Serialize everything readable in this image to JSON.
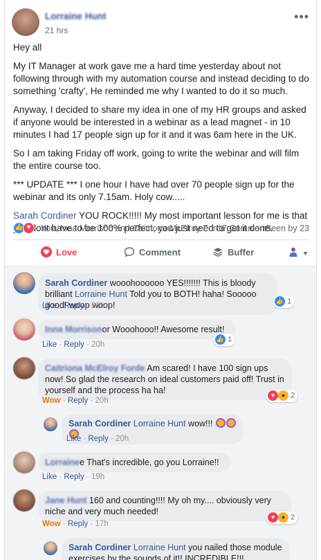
{
  "post": {
    "author": "Lorraine Hunt",
    "time": "21 hrs",
    "more": "•••",
    "paragraphs": [
      "Hey all",
      "My IT Manager at work gave me a hard time yesterday about not following through with my automation course and instead deciding to do something 'crafty', He reminded me why I wanted to do it so much.",
      "Anyway, I decided to share my idea in one of my HR groups and asked if anyone would be interested in a webinar as a lead magnet - in 10 minutes I had 17 people sign up for it and it was 6am here in the UK.",
      "So I am taking Friday off work, going to write the webinar and will film the entire course too.",
      "*** UPDATE *** I one hour I have had over 70 people sign up for the webinar and its only 7.15am. Holy cow....."
    ],
    "shoutout_name": "Sarah Cordiner",
    "shoutout_text": " YOU ROCK!!!!! My most important lesson for me is that you dont have to be 100% perfect, you just need to get it done.",
    "reacted_by": "You, Inna Morrison and Caitriona McElroy Forde",
    "comments_count": "7 Comments",
    "seen_by": "Seen by 23"
  },
  "actions": {
    "love": "Love",
    "comment": "Comment",
    "buffer": "Buffer"
  },
  "comments": [
    {
      "author": "Sarah Cordiner",
      "mention": "Lorraine Hunt",
      "text_before": " wooohoooooo YES!!!!!!! This is bloody brilliant ",
      "text_after": " Told you to BOTH! haha! Sooooo good! woop woop!",
      "like": "Like",
      "reply": "Reply",
      "time": "21h",
      "reaction_count": "1"
    },
    {
      "author_blurred": "Inna Morrison",
      "text": "or Wooohooo!! Awesome result!",
      "like": "Like",
      "reply": "Reply",
      "time": "20h",
      "reaction_count": "1"
    },
    {
      "author_blurred": "Caitriona McElroy Forde",
      "text": " Am scared! I have 100 sign ups now! So glad the research on ideal customers paid off! Trust in yourself and the process ha ha!",
      "like": "Wow",
      "reply": "Reply",
      "time": "20h",
      "reaction_count": "2"
    },
    {
      "author": "Sarah Cordiner",
      "mention": "Lorraine Hunt",
      "text": " wow!!!",
      "like": "Like",
      "reply": "Reply",
      "time": "20h"
    },
    {
      "author_blurred": "Lorraine",
      "text": "e That's incredible, go you Lorraine!!",
      "like": "Like",
      "reply": "Reply",
      "time": "19h"
    },
    {
      "author_blurred": "Jane Hunt",
      "text": " 160 and counting!!!! My oh my.... obviously very niche and very much needed!",
      "like": "Wow",
      "reply": "Reply",
      "time": "17h",
      "reaction_count": "2"
    },
    {
      "author": "Sarah Cordiner",
      "mention": "Lorraine Hunt",
      "text": " you nailed those module exercises by the sounds of it!! INCREDIBLE!!!"
    }
  ],
  "colors": {
    "link": "#385898",
    "love": "#f33e58",
    "like": "#2d88ff",
    "wow": "#e9710f"
  }
}
